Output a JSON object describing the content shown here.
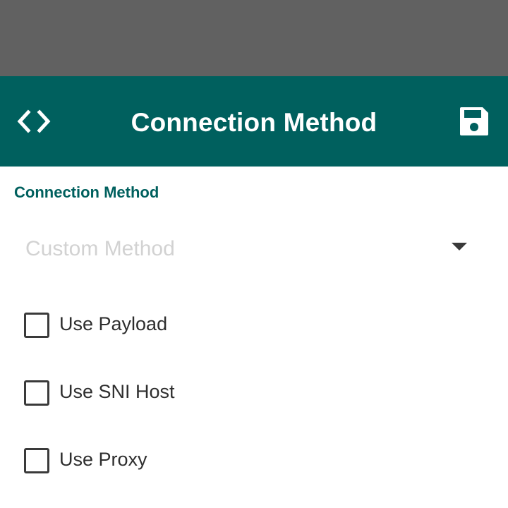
{
  "app_bar": {
    "title": "Connection Method",
    "background_color": "#00605e",
    "left_icon": "code-brackets-icon",
    "right_icon": "save-floppy-icon"
  },
  "form": {
    "section_label": "Connection Method",
    "spinner": {
      "value": "Custom Method",
      "disabled": true,
      "arrow_icon": "dropdown-triangle-icon"
    },
    "options": [
      {
        "label": "Use Payload",
        "checked": false
      },
      {
        "label": "Use SNI Host",
        "checked": false
      },
      {
        "label": "Use Proxy",
        "checked": false
      }
    ]
  },
  "colors": {
    "status_area": "#616161",
    "accent": "#00605e",
    "disabled_text": "#d2d2d2",
    "text": "#2e2e2e"
  }
}
